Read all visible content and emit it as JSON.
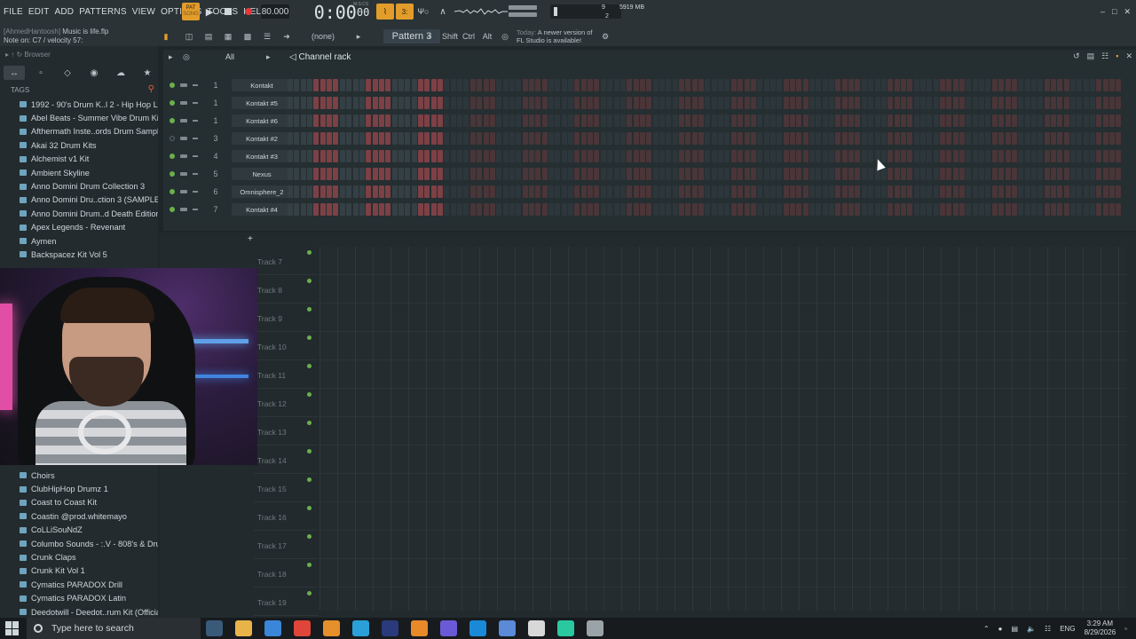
{
  "menu": [
    "FILE",
    "EDIT",
    "ADD",
    "PATTERNS",
    "VIEW",
    "OPTIONS",
    "TOOLS",
    "HELP"
  ],
  "hint": {
    "user": "[AhmedHantoosh]",
    "project": "Music is life.flp",
    "note": "Note on: C7 / velocity 57:"
  },
  "transport": {
    "pat_label": "PAT",
    "song_label": "SONG",
    "play_icon": "play-icon",
    "stop_icon": "stop-icon",
    "record_icon": "record-icon",
    "tempo": "80.000",
    "time_main": "0:00",
    "time_sub": "00",
    "time_unit": "M:S:CS"
  },
  "tools": {
    "wt1": "⌇",
    "wt2": "3:",
    "wt3": "Ψ○",
    "wt4": "∧"
  },
  "monitor": {
    "cpu": "9",
    "voices": "2",
    "memory": "5919 MB"
  },
  "window_controls": [
    "–",
    "□",
    "✕"
  ],
  "row2": {
    "pattern": "Pattern 3",
    "snap": "(none)",
    "shift": "Shift",
    "ctrl": "Ctrl",
    "alt": "Alt",
    "news_line1_muted": "Today:",
    "news_line1": "A newer version of",
    "news_line2": "FL Studio is available!"
  },
  "browser": {
    "title": "Browser",
    "tags_label": "TAGS",
    "folders_top": [
      "1992 - 90's Drum K..l 2 - Hip Hop Lofi",
      "Abel Beats - Summer Vibe Drum Kit",
      "Afthermath Inste..ords Drum Samples",
      "Akai 32 Drum Kits",
      "Alchemist v1 Kit",
      "Ambient Skyline",
      "Anno Domini Drum Collection 3",
      "Anno Domini Dru..ction 3 (SAMPLER)",
      "Anno Domini Drum..d Death Edition 3",
      "Apex Legends - Revenant",
      "Aymen",
      "Backspacez Kit Vol 5"
    ],
    "folders_bottom": [
      "Choirs",
      "ClubHipHop Drumz 1",
      "Coast to Coast Kit",
      "Coastin @prod.whitemayo",
      "CoLLiSouNdZ",
      "Columbo Sounds - :.V - 808's & Drums",
      "Crunk Claps",
      "Crunk Kit Vol 1",
      "Cymatics PARADOX Drill",
      "Cymatics PARADOX Latin",
      "Deedotwill - Deedot..rum Kit (Official)"
    ]
  },
  "channel_rack": {
    "filter": "All",
    "title": "Channel rack",
    "channels": [
      {
        "num": "1",
        "name": "Kontakt",
        "led": true,
        "meter": false
      },
      {
        "num": "1",
        "name": "Kontakt #5",
        "led": true,
        "meter": false
      },
      {
        "num": "1",
        "name": "Kontakt #6",
        "led": true,
        "meter": false
      },
      {
        "num": "3",
        "name": "Kontakt #2",
        "led": false,
        "meter": true
      },
      {
        "num": "4",
        "name": "Kontakt #3",
        "led": true,
        "meter": false
      },
      {
        "num": "5",
        "name": "Nexus",
        "led": true,
        "meter": false
      },
      {
        "num": "6",
        "name": "Omnisphere_2",
        "led": true,
        "meter": false
      },
      {
        "num": "7",
        "name": "Kontakt #4",
        "led": true,
        "meter": false
      }
    ]
  },
  "playlist": {
    "add_label": "+",
    "tracks": [
      "Track 7",
      "Track 8",
      "Track 9",
      "Track 10",
      "Track 11",
      "Track 12",
      "Track 13",
      "Track 14",
      "Track 15",
      "Track 16",
      "Track 17",
      "Track 18",
      "Track 19"
    ]
  },
  "taskbar": {
    "search_placeholder": "Type here to search",
    "apps": [
      "#3a5a7a",
      "#e8b44a",
      "#3a86d8",
      "#e0453a",
      "#e6902c",
      "#2aa0d8",
      "#2a3a7a",
      "#e8892a",
      "#6a5ad8",
      "#1a8ad8",
      "#5a8ad8",
      "#d8d8d8",
      "#2ac8a0",
      "#9aa4a8"
    ],
    "lang": "ENG",
    "time": "3:29 AM",
    "date": "8/29/2026"
  },
  "colors": {
    "accent": "#e29c2a",
    "led_on": "#6ab04c",
    "step_red": "#7d4045"
  }
}
